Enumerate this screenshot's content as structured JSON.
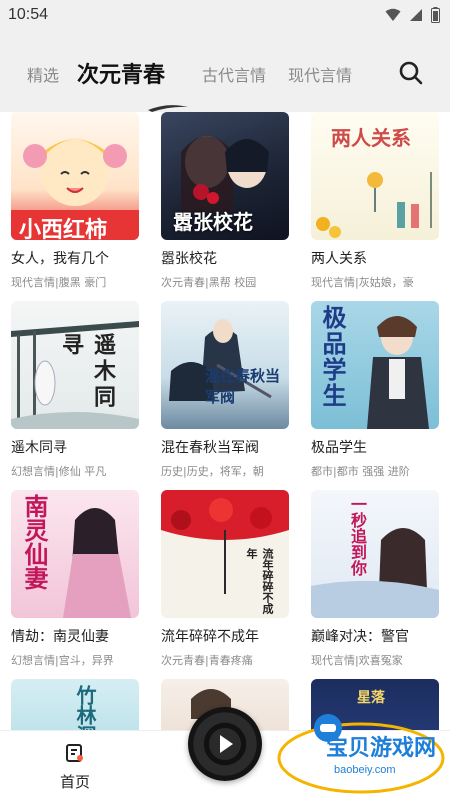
{
  "status_bar": {
    "time": "10:54"
  },
  "tabs": [
    {
      "label": "精选"
    },
    {
      "label": "次元青春"
    },
    {
      "label": "古代言情"
    },
    {
      "label": "现代言情"
    }
  ],
  "books": [
    {
      "title": "女人，我有几个",
      "tags": "现代言情|腹黑 豪门",
      "cover_text": "小西红柿"
    },
    {
      "title": "嚣张校花",
      "tags": "次元青春|黑帮 校园",
      "cover_text": "嚣张校花"
    },
    {
      "title": "两人关系",
      "tags": "现代言情|灰姑娘，豪",
      "cover_text": "两人关系"
    },
    {
      "title": "遥木同寻",
      "tags": "幻想言情|修仙 平凡",
      "cover_text": "遥木同寻"
    },
    {
      "title": "混在春秋当军阀",
      "tags": "历史|历史，将军，朝",
      "cover_text": "混在春秋当军阀"
    },
    {
      "title": "极品学生",
      "tags": "都市|都市 强强 进阶",
      "cover_text": "极品学生"
    },
    {
      "title": "情劫：南灵仙妻",
      "tags": "幻想言情|宫斗，异界",
      "cover_text": "南灵仙妻"
    },
    {
      "title": "流年碎碎不成年",
      "tags": "次元青春|青春疼痛",
      "cover_text": "流年碎碎不成年"
    },
    {
      "title": "巅峰对决：警官",
      "tags": "现代言情|欢喜冤家",
      "cover_text": "一秒追到你"
    },
    {
      "title": "",
      "tags": "",
      "cover_text": "竹林深"
    },
    {
      "title": "",
      "tags": "",
      "cover_text": ""
    },
    {
      "title": "",
      "tags": "",
      "cover_text": "星落"
    }
  ],
  "bottom_nav": {
    "home_label": "首页"
  },
  "watermark": {
    "text": "宝贝游戏网",
    "url": "baobeiy.com"
  },
  "colors": {
    "header_bg": "#f0f0f0",
    "active_tab": "#111111",
    "inactive_tab": "#8a8a8a",
    "tag_text": "#8a8a8a",
    "watermark": "#1e7fd8"
  },
  "icons": {
    "search": "search-icon",
    "home": "home-book-icon",
    "play": "play-icon",
    "wifi": "wifi-icon",
    "signal": "signal-icon",
    "battery": "battery-icon"
  }
}
